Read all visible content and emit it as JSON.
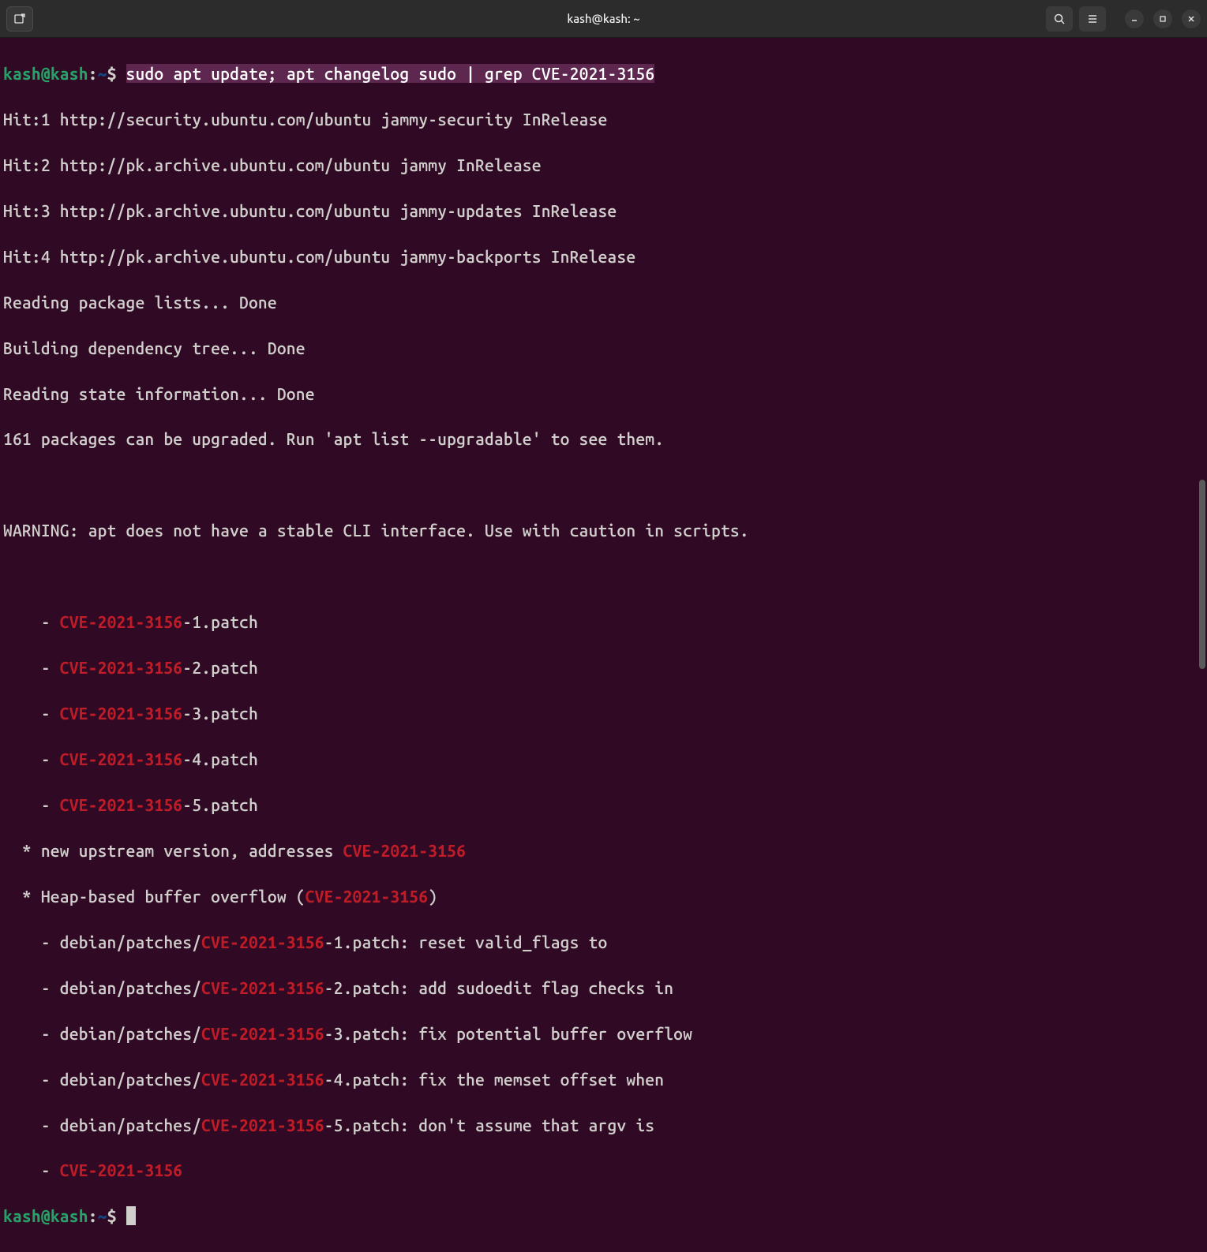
{
  "titlebar": {
    "title": "kash@kash: ~"
  },
  "prompt": {
    "user": "kash",
    "host": "kash",
    "path": "~",
    "symbol": "$"
  },
  "command": "sudo apt update; apt changelog sudo | grep CVE-2021-3156",
  "output": {
    "hits": [
      "Hit:1 http://security.ubuntu.com/ubuntu jammy-security InRelease",
      "Hit:2 http://pk.archive.ubuntu.com/ubuntu jammy InRelease",
      "Hit:3 http://pk.archive.ubuntu.com/ubuntu jammy-updates InRelease",
      "Hit:4 http://pk.archive.ubuntu.com/ubuntu jammy-backports InRelease"
    ],
    "reading_lists": "Reading package lists... Done",
    "building_tree": "Building dependency tree... Done",
    "reading_state": "Reading state information... Done",
    "upgradable": "161 packages can be upgraded. Run 'apt list --upgradable' to see them.",
    "warning": "WARNING: apt does not have a stable CLI interface. Use with caution in scripts."
  },
  "cve": "CVE-2021-3156",
  "grep_lines": {
    "p1_pre": "    - ",
    "p1_suf": "-1.patch",
    "p2_suf": "-2.patch",
    "p3_suf": "-3.patch",
    "p4_suf": "-4.patch",
    "p5_suf": "-5.patch",
    "upstream_pre": "  * new upstream version, addresses ",
    "heap_pre": "  * Heap-based buffer overflow (",
    "heap_suf": ")",
    "deb_pre": "    - debian/patches/",
    "d1_suf": "-1.patch: reset valid_flags to",
    "d2_suf": "-2.patch: add sudoedit flag checks in",
    "d3_suf": "-3.patch: fix potential buffer overflow",
    "d4_suf": "-4.patch: fix the memset offset when",
    "d5_suf": "-5.patch: don't assume that argv is",
    "last_pre": "    - "
  }
}
